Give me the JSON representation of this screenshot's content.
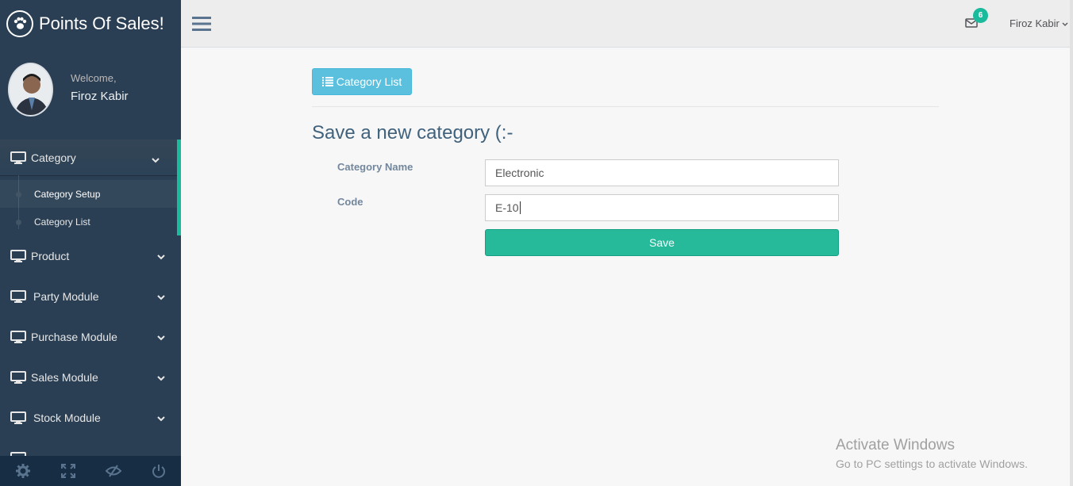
{
  "app": {
    "title": "Points Of Sales!"
  },
  "profile": {
    "welcome": "Welcome,",
    "name": "Firoz Kabir"
  },
  "sidebar": {
    "items": [
      {
        "label": "Category",
        "expanded": true,
        "children": [
          {
            "label": "Category Setup",
            "active": true
          },
          {
            "label": "Category List"
          }
        ]
      },
      {
        "label": "Product"
      },
      {
        "label": "Party Module"
      },
      {
        "label": "Purchase Module"
      },
      {
        "label": "Sales Module"
      },
      {
        "label": "Stock Module"
      }
    ],
    "footer_icons": [
      "settings-icon",
      "fullscreen-icon",
      "lock-icon",
      "logout-icon"
    ]
  },
  "topnav": {
    "mail_count": "6",
    "user_name": "Firoz Kabir"
  },
  "main": {
    "list_button": "Category List",
    "heading": "Save a new category (:-",
    "fields": [
      {
        "label": "Category Name",
        "value": "Electronic"
      },
      {
        "label": "Code",
        "value": "E-10"
      }
    ],
    "save_button": "Save"
  },
  "watermark": {
    "line1": "Activate Windows",
    "line2": "Go to PC settings to activate Windows."
  },
  "colors": {
    "sidebar": "#2a3f54",
    "accent": "#1abb9c",
    "save": "#26b99a",
    "info": "#5bc0de"
  }
}
